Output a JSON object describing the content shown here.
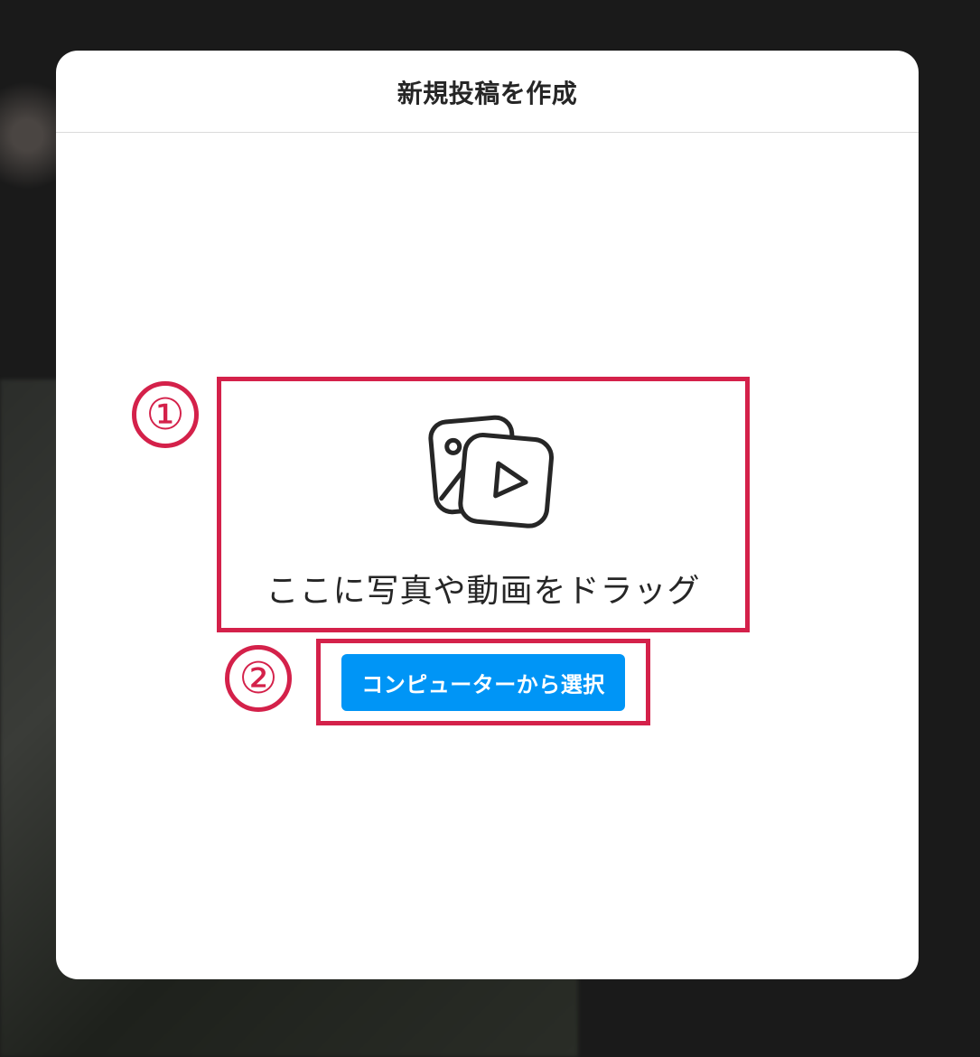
{
  "modal": {
    "title": "新規投稿を作成",
    "drop_text": "ここに写真や動画をドラッグ",
    "select_button_label": "コンピューターから選択"
  },
  "annotations": {
    "callout1": "①",
    "callout2": "②"
  },
  "colors": {
    "annotation": "#d4214a",
    "button_bg": "#0095f6",
    "button_text": "#ffffff"
  }
}
